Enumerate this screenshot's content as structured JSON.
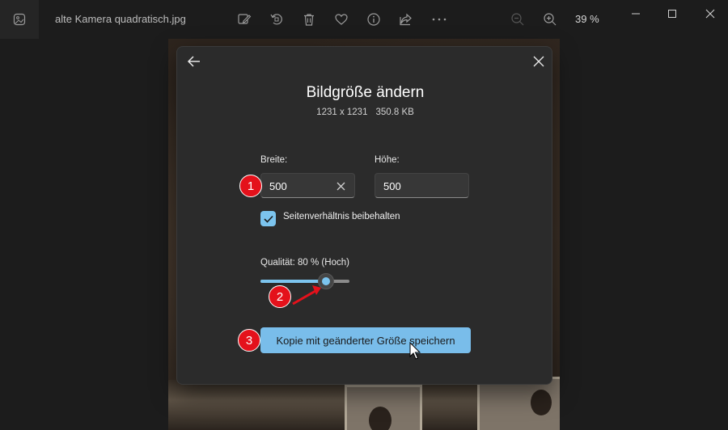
{
  "window": {
    "file_name": "alte Kamera quadratisch.jpg",
    "zoom_level": "39 %"
  },
  "toolbar": {
    "icons": [
      "edit-image-icon",
      "rotate-icon",
      "delete-icon",
      "favorite-heart-icon",
      "info-icon",
      "share-icon",
      "more-icon"
    ],
    "zoom_icons": [
      "zoom-out-icon",
      "zoom-in-icon"
    ]
  },
  "dialog": {
    "title": "Bildgröße ändern",
    "dimensions": "1231 x 1231",
    "file_size": "350.8 KB",
    "width_label": "Breite:",
    "width_value": "500",
    "height_label": "Höhe:",
    "height_value": "500",
    "aspect_ratio_label": "Seitenverhältnis beibehalten",
    "aspect_ratio_checked": true,
    "quality_label": "Qualität: 80 % (Hoch)",
    "quality_slider_fraction": 0.74,
    "save_label": "Kopie mit geänderter Größe speichern"
  },
  "annotations": {
    "marker_1": "1",
    "marker_2": "2",
    "marker_3": "3"
  },
  "colors": {
    "accent": "#79bdea",
    "marker": "#e4111b",
    "dialog_bg": "#2b2b2b",
    "app_bg": "#1c1c1c"
  }
}
